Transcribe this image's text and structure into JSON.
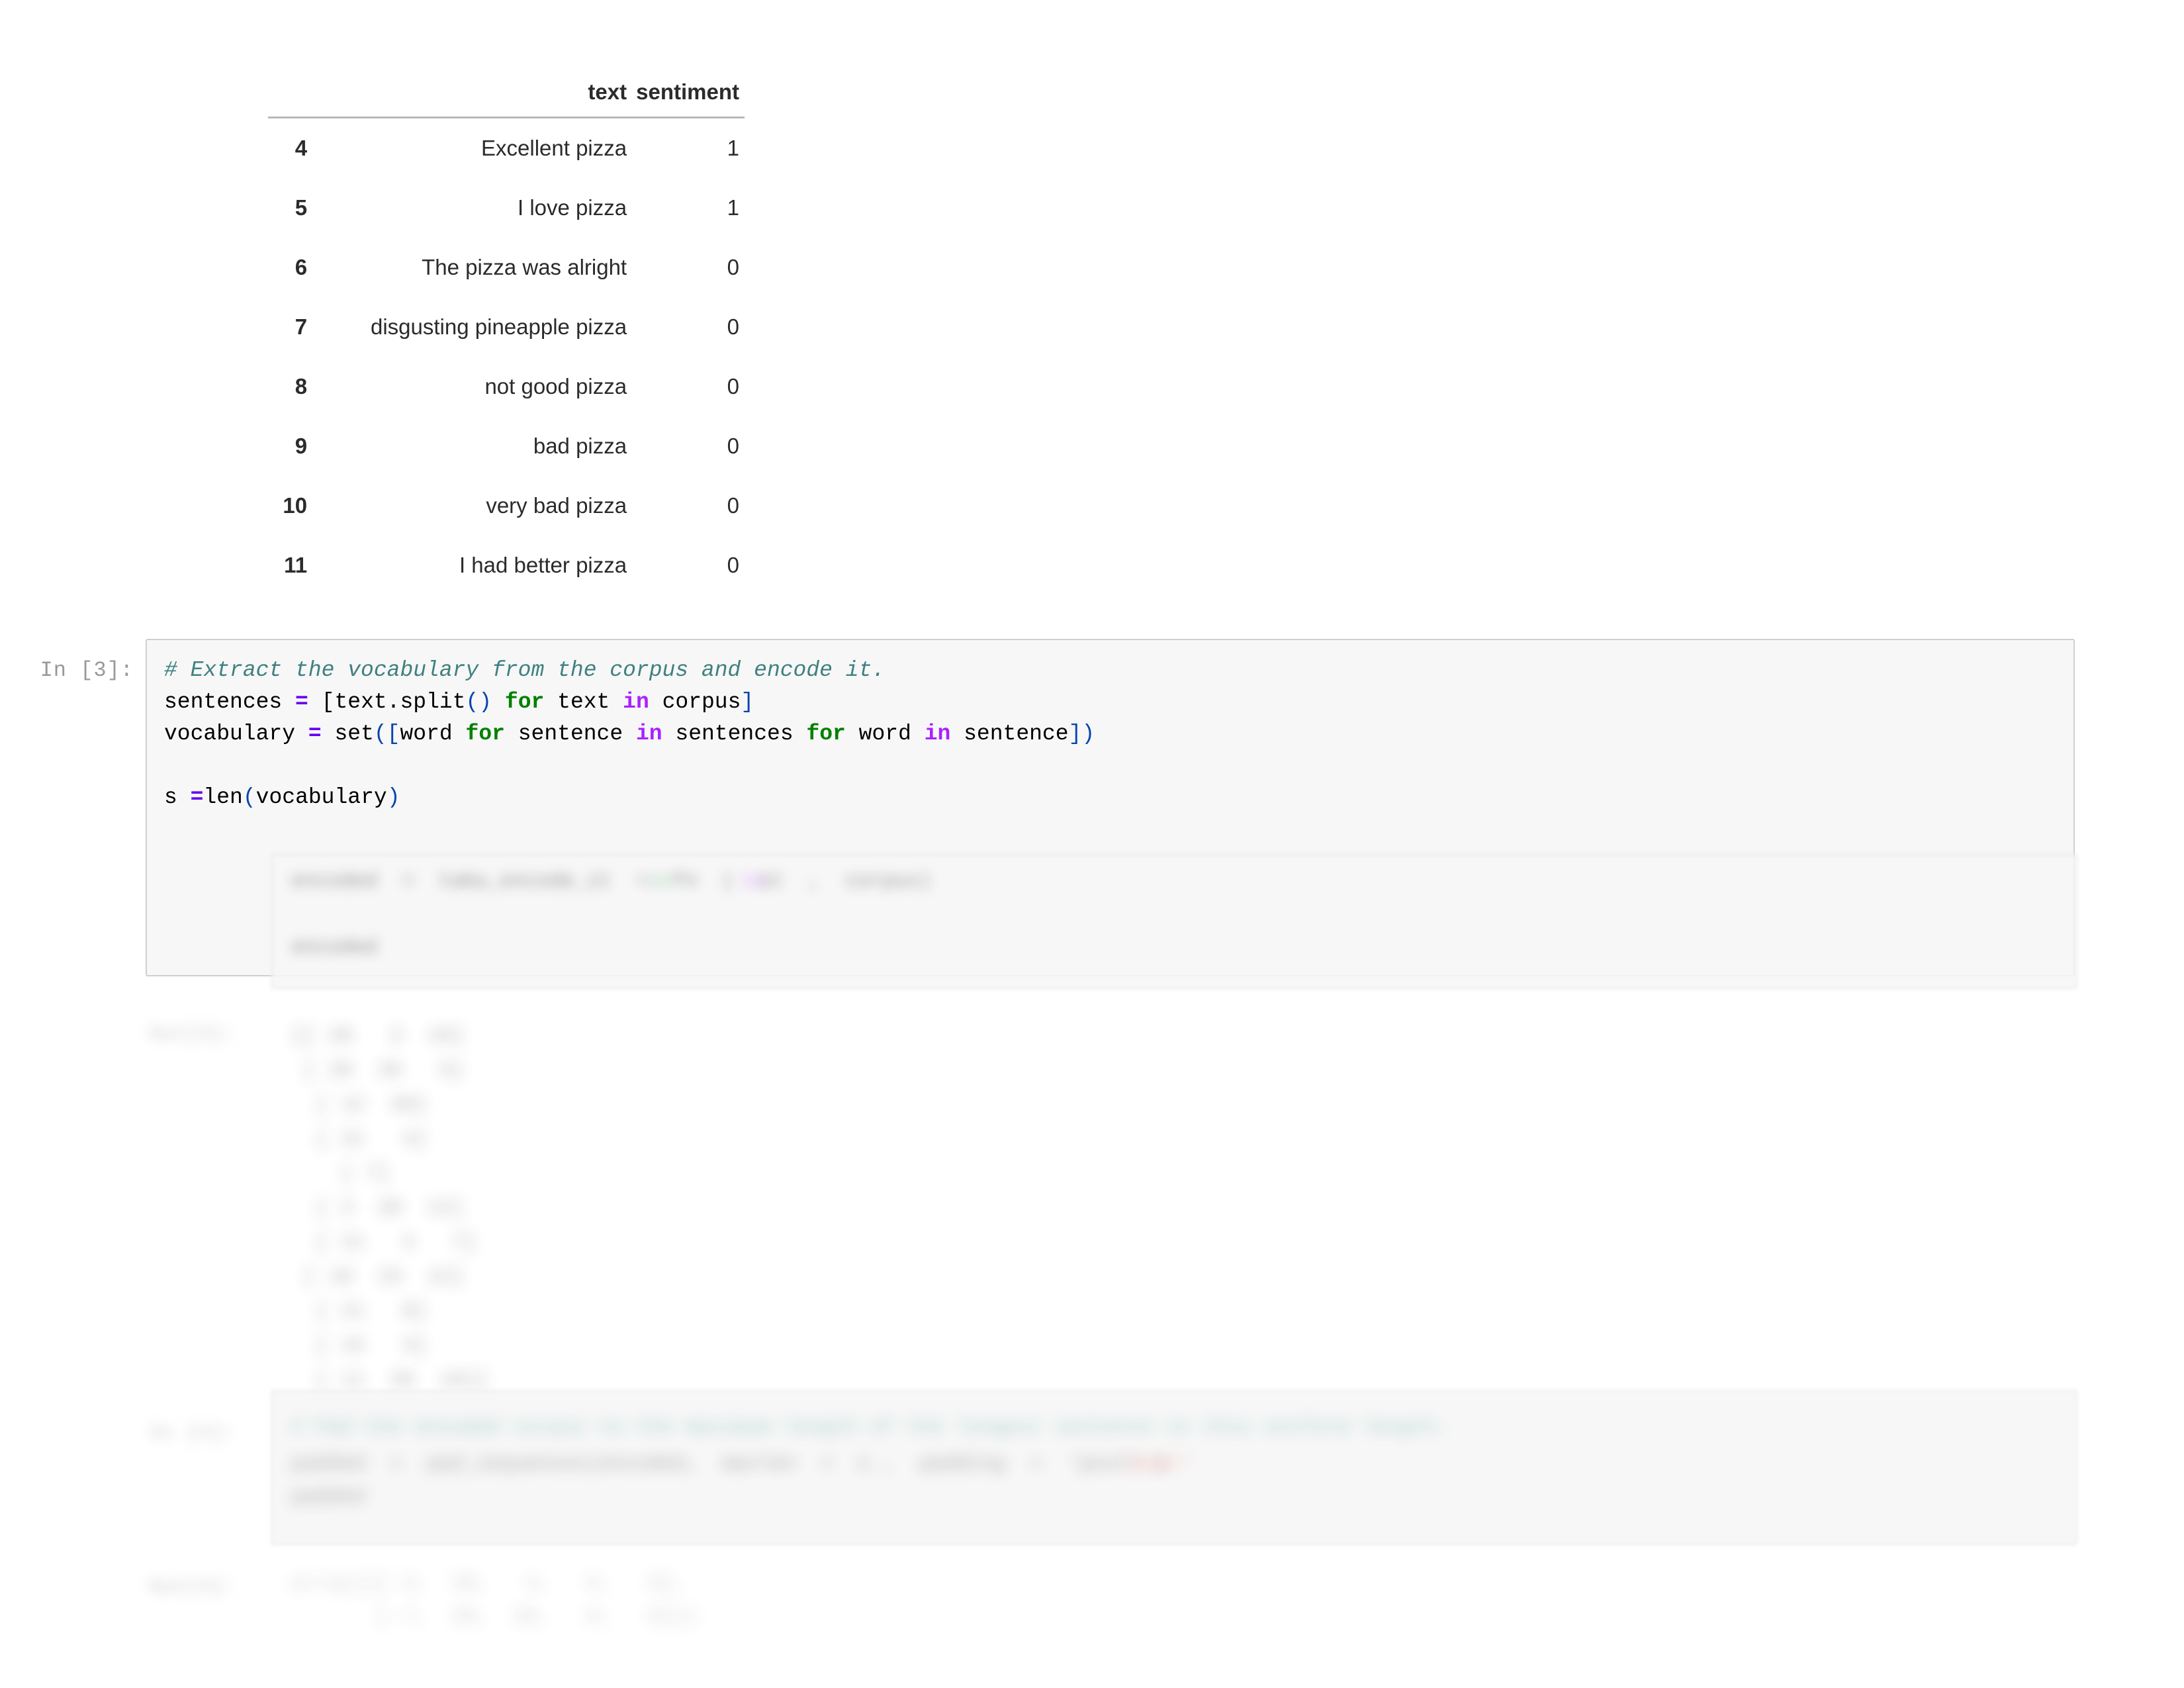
{
  "notebook": {
    "dataframe": {
      "columns": [
        "text",
        "sentiment"
      ],
      "index_header": "",
      "rows": [
        {
          "index": "4",
          "text": "Excellent pizza",
          "sentiment": "1"
        },
        {
          "index": "5",
          "text": "I love pizza",
          "sentiment": "1"
        },
        {
          "index": "6",
          "text": "The pizza was alright",
          "sentiment": "0"
        },
        {
          "index": "7",
          "text": "disgusting pineapple pizza",
          "sentiment": "0"
        },
        {
          "index": "8",
          "text": "not good pizza",
          "sentiment": "0"
        },
        {
          "index": "9",
          "text": "bad pizza",
          "sentiment": "0"
        },
        {
          "index": "10",
          "text": "very bad pizza",
          "sentiment": "0"
        },
        {
          "index": "11",
          "text": "I had better pizza",
          "sentiment": "0"
        }
      ]
    },
    "cell_in_3": {
      "prompt": "In [3]:",
      "code": {
        "line1_comment": "# Extract the vocabulary from the corpus and encode it.",
        "line2_a": "sentences ",
        "line2_eq": "=",
        "line2_b": " [text.split",
        "line2_paren1": "()",
        "line2_c": " ",
        "line2_for": "for",
        "line2_d": " text ",
        "line2_in": "in",
        "line2_e": " corpus",
        "line2_brk": "]",
        "line3_a": "vocabulary ",
        "line3_eq": "=",
        "line3_b": " set",
        "line3_open": "([",
        "line3_c": "word ",
        "line3_for1": "for",
        "line3_d": " sentence ",
        "line3_in1": "in",
        "line3_e": " sentences ",
        "line3_for2": "for",
        "line3_f": " word ",
        "line3_in2": "in",
        "line3_g": " sentence",
        "line3_close": "])",
        "line5_a": "s ",
        "line5_eq": "=",
        "line5_b": "len",
        "line5_open": "(",
        "line5_c": "vocabulary",
        "line5_close": ")"
      },
      "redacted_line_1": "encoded  =  tabu_encode_it  +  fn  (  it  ,  corpus)",
      "redacted_line_2": "encoded"
    },
    "redacted_output_block": {
      "note": "blurred array output",
      "lines": [
        "[[  28   3   19]",
        " [  28   26   5]",
        "  [ 12   28]",
        " [ 21   4]",
        "   [ 7]",
        "  [ 3   28   12]",
        "  [ 21   4   7]",
        " [ 18   23   12]",
        "  [ 21   8]",
        "  [ 15   3]",
        "  [ 11   28   19]"
      ]
    },
    "cell_redacted_next": {
      "prompt": "In [4]:",
      "lines": [
        "# Pad the encoded corpus to the maximum length of the longest sentence in this uniform length.",
        "padded  =  pad_sequences(encoded,  maxlen  =  s ,  padding  =  'post' )",
        "padded"
      ]
    },
    "redacted_output_block_2": {
      "prompt": "Out[4]:",
      "lines": [
        "array([[ 3,  28,   4,   5,   0],",
        "       [ 7,  28,  26,   0,   0]])"
      ]
    }
  }
}
